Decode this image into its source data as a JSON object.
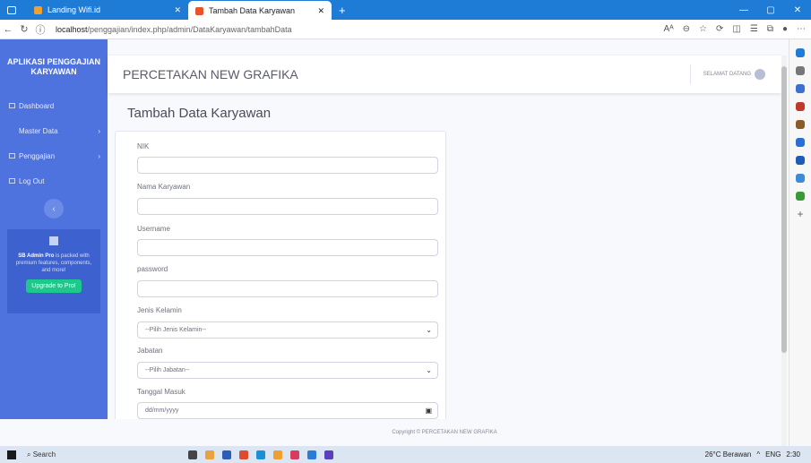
{
  "browser": {
    "tabs": [
      {
        "label": "Landing Wifi.id",
        "active": false
      },
      {
        "label": "Tambah Data Karyawan",
        "active": true
      }
    ],
    "url_host": "localhost",
    "url_path": "/penggajian/index.php/admin/DataKaryawan/tambahData"
  },
  "sidebar": {
    "brand": "APLIKASI PENGGAJIAN KARYAWAN",
    "items": [
      {
        "label": "Dashboard"
      },
      {
        "label": "Master Data"
      },
      {
        "label": "Penggajian"
      },
      {
        "label": "Log Out"
      }
    ],
    "toggle": "‹",
    "promo_bold": "SB Admin Pro",
    "promo_text": " is packed with premium features, components, and more!",
    "promo_button": "Upgrade to Pro!"
  },
  "topbar": {
    "title": "PERCETAKAN NEW GRAFIKA",
    "welcome": "SELAMAT DATANG"
  },
  "page": {
    "title": "Tambah Data Karyawan"
  },
  "form": {
    "nik_label": "NIK",
    "nama_label": "Nama Karyawan",
    "username_label": "Username",
    "password_label": "password",
    "jk_label": "Jenis Kelamin",
    "jk_selected": "--Pilih Jenis Kelamin--",
    "jabatan_label": "Jabatan",
    "jabatan_selected": "--Pilih Jabatan--",
    "tgl_label": "Tanggal Masuk",
    "tgl_placeholder": "dd/mm/yyyy"
  },
  "footer": "Copyright © PERCETAKAN NEW GRAFIKA",
  "taskbar": {
    "search": "Search",
    "weather": "26°C Berawan",
    "lang": "ENG",
    "time": "2:30"
  }
}
